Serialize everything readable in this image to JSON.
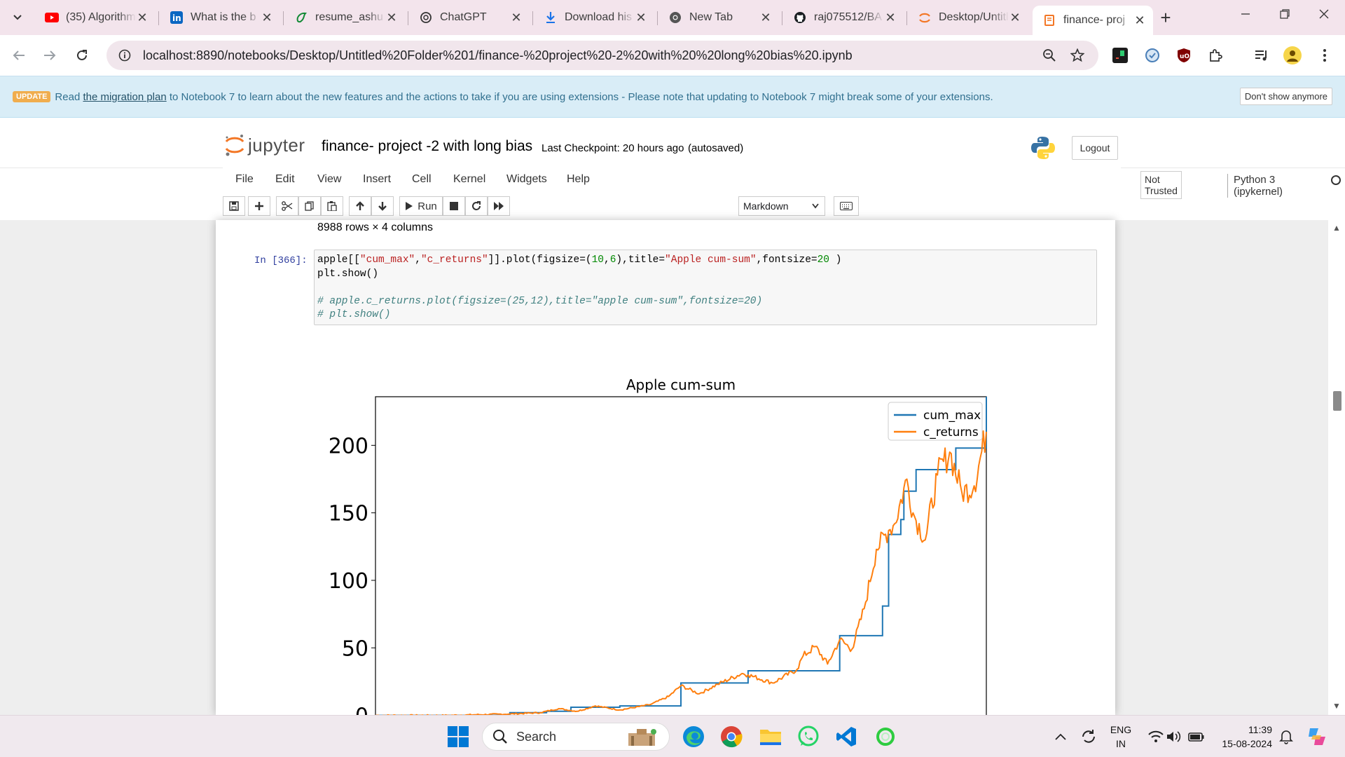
{
  "browser": {
    "tabs": [
      {
        "title": "(35) Algorithm",
        "icon": "youtube-icon"
      },
      {
        "title": "What is the b",
        "icon": "linkedin-icon"
      },
      {
        "title": "resume_ashu",
        "icon": "overleaf-icon"
      },
      {
        "title": "ChatGPT",
        "icon": "chatgpt-icon"
      },
      {
        "title": "Download his",
        "icon": "download-icon"
      },
      {
        "title": "New Tab",
        "icon": "chrome-icon"
      },
      {
        "title": "raj075512/BA",
        "icon": "github-icon"
      },
      {
        "title": "Desktop/Untitl",
        "icon": "jupyter-icon"
      },
      {
        "title": "finance- proj",
        "icon": "notebook-icon",
        "active": true
      }
    ],
    "url": "localhost:8890/notebooks/Desktop/Untitled%20Folder%201/finance-%20project%20-2%20with%20%20long%20bias%20.ipynb",
    "tab_close": "✕",
    "new_tab": "+"
  },
  "banner": {
    "badge": "UPDATE",
    "prefix": "Read",
    "link": "the migration plan",
    "text": "to Notebook 7 to learn about the new features and the actions to take if you are using extensions - Please note that updating to Notebook 7 might break some of your extensions.",
    "dismiss": "Don't show anymore"
  },
  "header": {
    "wordmark": "jupyter",
    "notebook_name": "finance- project -2 with long bias",
    "checkpoint": "Last Checkpoint: 20 hours ago",
    "autosaved": "(autosaved)",
    "logout": "Logout"
  },
  "menubar": {
    "items": [
      "File",
      "Edit",
      "View",
      "Insert",
      "Cell",
      "Kernel",
      "Widgets",
      "Help"
    ],
    "not_trusted": "Not Trusted",
    "kernel": "Python 3 (ipykernel)"
  },
  "toolbar": {
    "run_label": "Run",
    "cell_type": "Markdown"
  },
  "notebook": {
    "row_count": "8988 rows × 4 columns",
    "prompt": "In [366]:",
    "code": {
      "l1_a": "apple[[",
      "l1_s1": "\"cum_max\"",
      "l1_b": ",",
      "l1_s2": "\"c_returns\"",
      "l1_c": "]].plot(figsize=(",
      "l1_n1": "10",
      "l1_d": ",",
      "l1_n2": "6",
      "l1_e": "),title=",
      "l1_s3": "\"Apple cum-sum\"",
      "l1_f": ",fontsize=",
      "l1_n3": "20",
      "l1_g": " )",
      "l2": "plt.show()",
      "l4": "# apple.c_returns.plot(figsize=(25,12),title=\"apple cum-sum\",fontsize=20)",
      "l5": "# plt.show()"
    }
  },
  "chart_data": {
    "type": "line",
    "title": "Apple cum-sum",
    "xlabel": "",
    "ylabel": "",
    "y_ticks": [
      0,
      50,
      100,
      150,
      200
    ],
    "ylim": [
      -8,
      236
    ],
    "x_points": 8988,
    "legend": {
      "position": "top-right",
      "entries": [
        "cum_max",
        "c_returns"
      ]
    },
    "colors": {
      "cum_max": "#1f77b4",
      "c_returns": "#ff7f0e"
    },
    "series": [
      {
        "name": "cum_max",
        "x": [
          0,
          0.12,
          0.22,
          0.28,
          0.32,
          0.4,
          0.49,
          0.5,
          0.6,
          0.61,
          0.69,
          0.7,
          0.75,
          0.76,
          0.82,
          0.83,
          0.835,
          0.84,
          0.845,
          0.86,
          0.865,
          0.885,
          0.89,
          0.94,
          0.95,
          1.0
        ],
        "y": [
          0,
          0,
          2,
          3,
          6,
          7,
          7,
          24,
          24,
          33,
          33,
          33,
          33,
          59,
          59,
          81,
          81,
          134,
          134,
          145,
          166,
          182,
          182,
          182,
          198,
          236
        ]
      },
      {
        "name": "c_returns",
        "x": [
          0,
          0.12,
          0.22,
          0.27,
          0.3,
          0.33,
          0.36,
          0.4,
          0.45,
          0.48,
          0.5,
          0.53,
          0.56,
          0.6,
          0.61,
          0.65,
          0.69,
          0.7,
          0.72,
          0.74,
          0.76,
          0.78,
          0.8,
          0.82,
          0.84,
          0.85,
          0.87,
          0.88,
          0.9,
          0.92,
          0.94,
          0.96,
          0.98,
          1.0
        ],
        "y": [
          0,
          0,
          1,
          2,
          5,
          3,
          7,
          4,
          8,
          14,
          22,
          16,
          23,
          31,
          30,
          24,
          34,
          44,
          51,
          38,
          56,
          49,
          79,
          123,
          137,
          142,
          175,
          150,
          130,
          178,
          195,
          165,
          170,
          210
        ]
      }
    ]
  },
  "taskbar": {
    "search": "Search",
    "lang_line1": "ENG",
    "lang_line2": "IN",
    "time": "11:39",
    "date": "15-08-2024"
  }
}
